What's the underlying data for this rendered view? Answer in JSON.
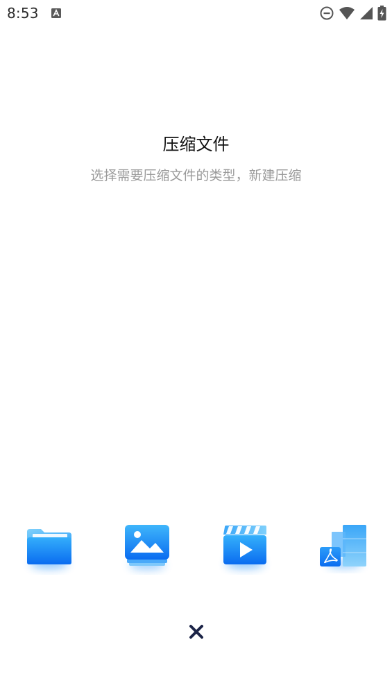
{
  "status_bar": {
    "time": "8:53",
    "app_icon": "a-text-icon",
    "icons": [
      "do-not-disturb-icon",
      "wifi-icon",
      "signal-icon",
      "battery-charging-icon"
    ]
  },
  "dialog": {
    "title": "压缩文件",
    "subtitle": "选择需要压缩文件的类型，新建压缩"
  },
  "options": [
    {
      "icon": "folder-icon"
    },
    {
      "icon": "image-icon"
    },
    {
      "icon": "video-icon"
    },
    {
      "icon": "pdf-document-icon"
    }
  ],
  "close": {
    "icon": "close-icon"
  },
  "colors": {
    "accent": "#1a7df5",
    "accent_light": "#5fc0fb",
    "close": "#1c2447",
    "subtitle": "#9a9a9a",
    "title": "#111111"
  }
}
